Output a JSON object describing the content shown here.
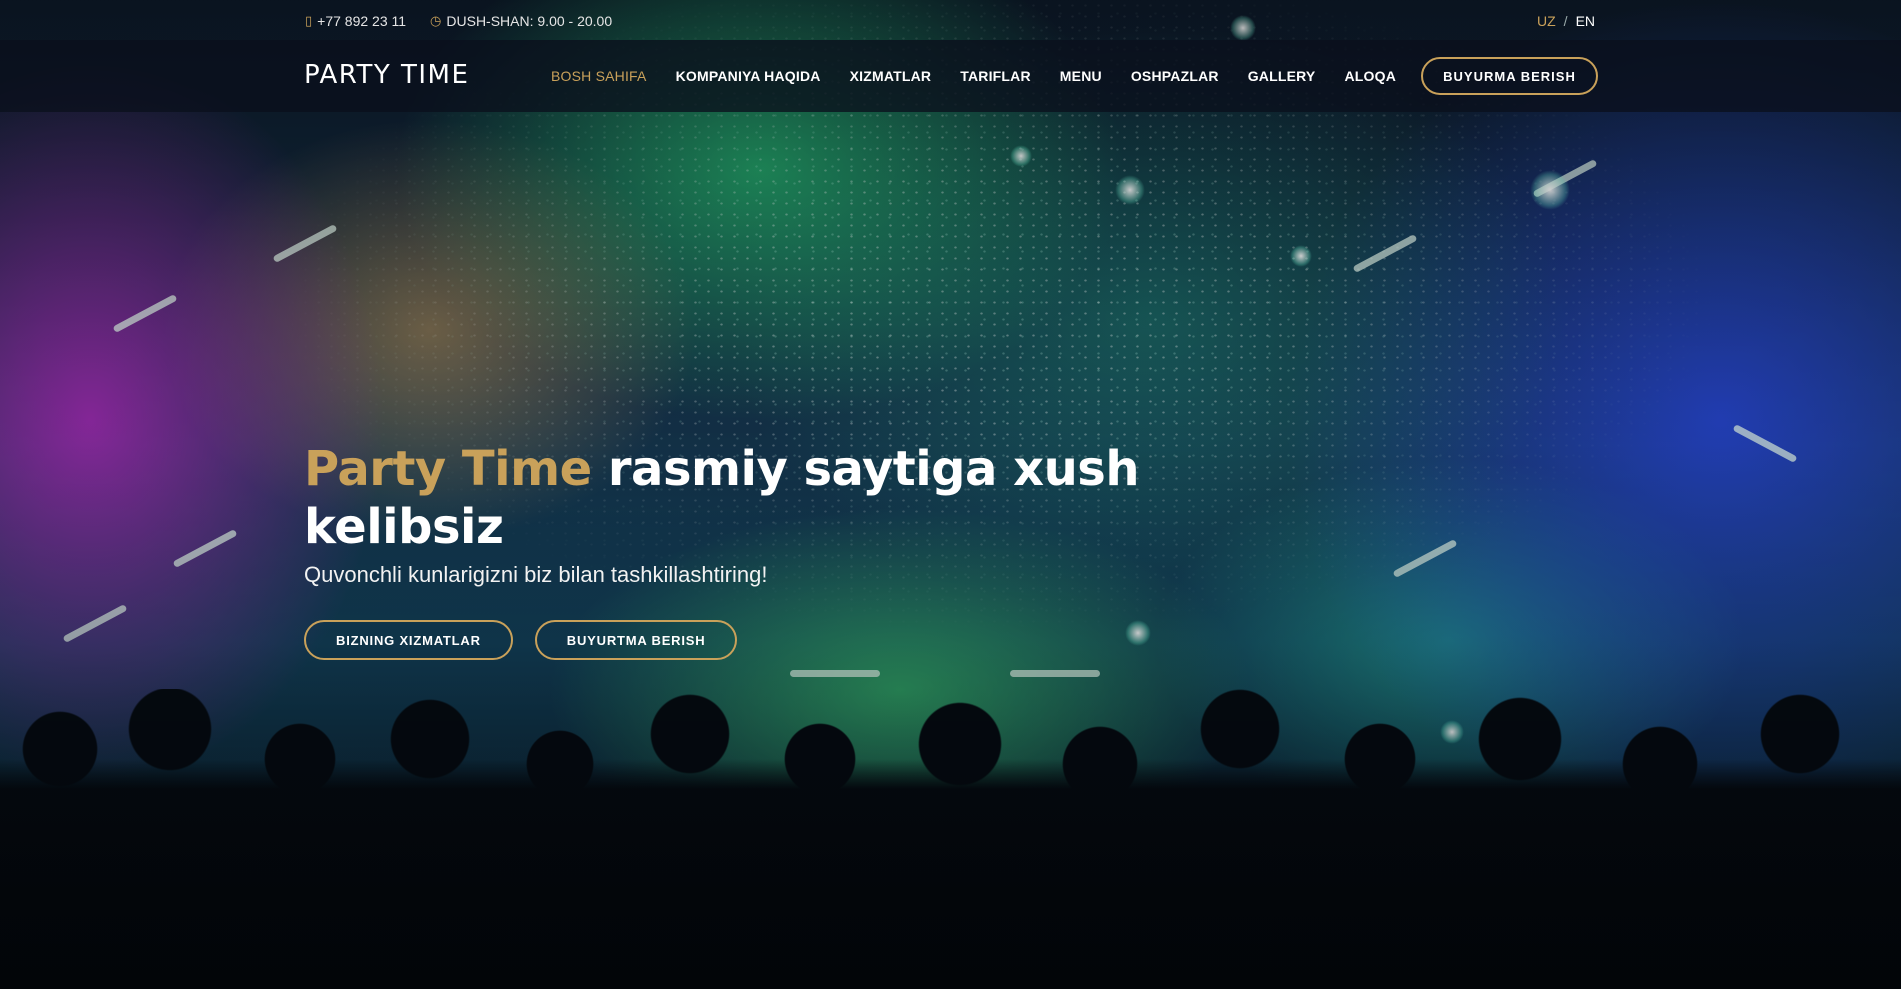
{
  "topbar": {
    "phone_icon": "phone-icon",
    "phone": "+77 892 23 11",
    "clock_icon": "clock-icon",
    "hours": "DUSH-SHAN: 9.00 - 20.00",
    "lang_active": "UZ",
    "lang_separator": "/",
    "lang_other": "EN"
  },
  "navbar": {
    "logo": "PARTY TIME",
    "items": [
      {
        "label": "BOSH SAHIFA",
        "active": true
      },
      {
        "label": "KOMPANIYA HAQIDA",
        "active": false
      },
      {
        "label": "XIZMATLAR",
        "active": false
      },
      {
        "label": "TARIFLAR",
        "active": false
      },
      {
        "label": "MENU",
        "active": false
      },
      {
        "label": "OSHPAZLAR",
        "active": false
      },
      {
        "label": "GALLERY",
        "active": false
      },
      {
        "label": "ALOQA",
        "active": false
      }
    ],
    "cta": "BUYURMA BERISH"
  },
  "hero": {
    "title_brand": "Party Time",
    "title_rest": " rasmiy saytiga xush kelibsiz",
    "subtitle": "Quvonchli kunlarigizni biz bilan tashkillashtiring!",
    "button_services": "BIZNING XIZMATLAR",
    "button_order": "BUYURTMA BERISH"
  },
  "colors": {
    "accent": "#c9a15a",
    "nav_background": "#0a101c",
    "text": "#ffffff"
  }
}
